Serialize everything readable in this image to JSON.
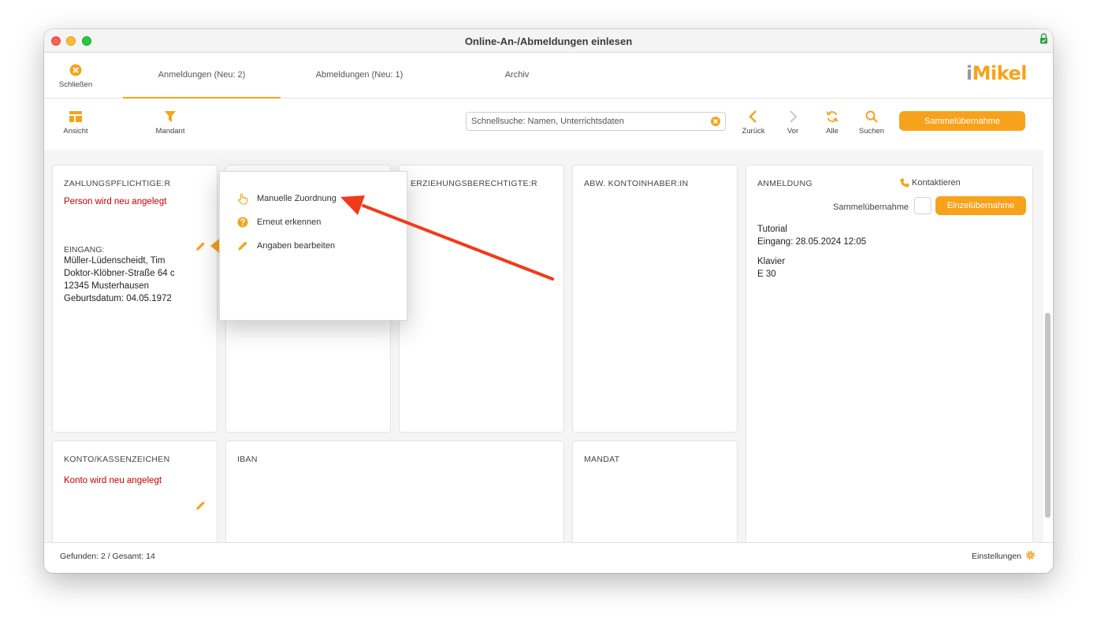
{
  "window": {
    "title": "Online-An-/Abmeldungen einlesen"
  },
  "tabbar": {
    "close_label": "Schließen",
    "tabs": [
      {
        "label": "Anmeldungen (Neu: 2)"
      },
      {
        "label": "Abmeldungen (Neu: 1)"
      },
      {
        "label": "Archiv"
      }
    ],
    "logo_i": "i",
    "logo_rest": "Mikel"
  },
  "toolbar": {
    "view_label": "Ansicht",
    "client_label": "Mandant",
    "search_placeholder": "Schnellsuche: Namen, Unterrichtsdaten",
    "back_label": "Zurück",
    "forward_label": "Vor",
    "all_label": "Alle",
    "search_label": "Suchen",
    "bulk_button": "Sammelübernahme"
  },
  "cards": {
    "payer": {
      "title": "ZAHLUNGSPFLICHTIGE:R",
      "status": "Person wird neu angelegt",
      "incoming_label": "EINGANG:",
      "lines": [
        "Müller-Lüdenscheidt, Tim",
        "Doktor-Klöbner-Straße 64 c",
        "12345 Musterhausen",
        "Geburtsdatum: 04.05.1972"
      ]
    },
    "guardian": {
      "title": "ERZIEHUNGSBERECHTIGTE:R"
    },
    "holder": {
      "title": "ABW. KONTOINHABER:IN"
    },
    "registration": {
      "title": "ANMELDUNG",
      "contact_label": "Kontaktieren",
      "bulk_label": "Sammelübernahme",
      "single_button": "Einzelübernahme",
      "lines": [
        "Tutorial",
        "Eingang: 28.05.2024 12:05"
      ],
      "lines2": [
        "Klavier",
        "E 30"
      ]
    },
    "account": {
      "title": "KONTO/KASSENZEICHEN",
      "status": "Konto wird neu angelegt"
    },
    "iban": {
      "title": "IBAN"
    },
    "mandate": {
      "title": "MANDAT"
    }
  },
  "popup_menu": {
    "items": [
      {
        "label": "Manuelle Zuordnung",
        "icon": "hand-pointer-icon"
      },
      {
        "label": "Erneut erkennen",
        "icon": "question-circle-icon"
      },
      {
        "label": "Angaben bearbeiten",
        "icon": "pencil-icon"
      }
    ]
  },
  "footer": {
    "found": "Gefunden: 2 / Gesamt: 14",
    "settings": "Einstellungen"
  },
  "colors": {
    "accent": "#f7a21b",
    "status_red": "#c40000",
    "arrow_red": "#f23a1a"
  }
}
